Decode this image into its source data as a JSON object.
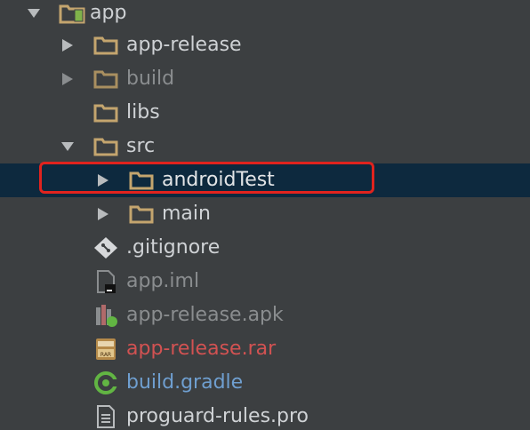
{
  "project_tree": {
    "items": [
      {
        "label": "app",
        "icon": "module-folder-icon",
        "expanded": true
      },
      {
        "label": "app-release",
        "icon": "folder-icon",
        "expanded": false
      },
      {
        "label": "build",
        "icon": "folder-icon",
        "expanded": false
      },
      {
        "label": "libs",
        "icon": "folder-icon"
      },
      {
        "label": "src",
        "icon": "folder-icon",
        "expanded": true
      },
      {
        "label": "androidTest",
        "icon": "folder-icon",
        "expanded": false,
        "selected": true
      },
      {
        "label": "main",
        "icon": "folder-icon",
        "expanded": false
      },
      {
        "label": ".gitignore",
        "icon": "git-file-icon"
      },
      {
        "label": "app.iml",
        "icon": "iml-file-icon"
      },
      {
        "label": "app-release.apk",
        "icon": "apk-file-icon"
      },
      {
        "label": "app-release.rar",
        "icon": "rar-archive-icon"
      },
      {
        "label": "build.gradle",
        "icon": "gradle-file-icon"
      },
      {
        "label": "proguard-rules.pro",
        "icon": "text-file-icon"
      }
    ]
  },
  "colors": {
    "background": "#3c3f41",
    "selection": "#0d293e",
    "highlight_border": "#e0231e",
    "text": "#cfd2d5",
    "dim_text": "#8a8d8f",
    "rar_text": "#d25252",
    "gradle_text": "#6f9fd0",
    "folder": "#c4a56e"
  }
}
